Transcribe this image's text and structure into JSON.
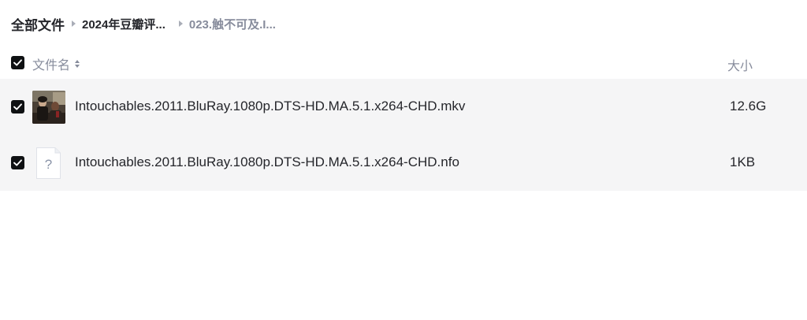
{
  "breadcrumb": {
    "root": "全部文件",
    "middle": "2024年豆瓣评...",
    "current": "023.触不可及.I..."
  },
  "header": {
    "name_label": "文件名",
    "size_label": "大小",
    "select_all_checked": true
  },
  "files": [
    {
      "name": "Intouchables.2011.BluRay.1080p.DTS-HD.MA.5.1.x264-CHD.mkv",
      "size": "12.6G",
      "icon": "video-thumbnail",
      "checked": true
    },
    {
      "name": "Intouchables.2011.BluRay.1080p.DTS-HD.MA.5.1.x264-CHD.nfo",
      "size": "1KB",
      "icon": "unknown-file-icon",
      "checked": true
    }
  ],
  "colors": {
    "checkbox": "#0f1113",
    "row_highlight": "#f5f5f6",
    "muted_text": "#878c9c",
    "text": "#25262b"
  }
}
